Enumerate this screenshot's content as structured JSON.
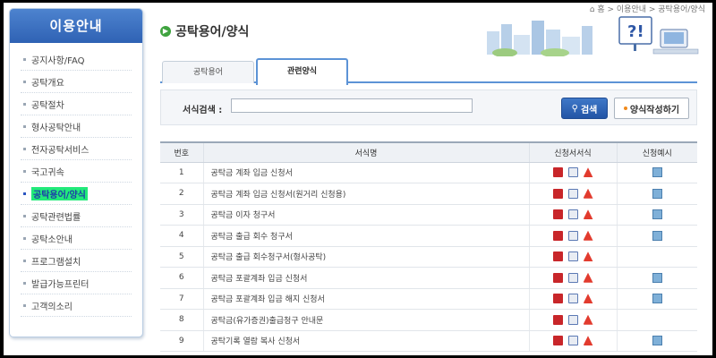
{
  "breadcrumb": [
    "홈",
    "이용안내",
    "공탁용어/양식"
  ],
  "sidebar": {
    "title": "이용안내",
    "items": [
      {
        "label": "공지사항/FAQ"
      },
      {
        "label": "공탁개요"
      },
      {
        "label": "공탁절차"
      },
      {
        "label": "형사공탁안내"
      },
      {
        "label": "전자공탁서비스"
      },
      {
        "label": "국고귀속"
      },
      {
        "label": "공탁용어/양식",
        "active": true
      },
      {
        "label": "공탁관련법률"
      },
      {
        "label": "공탁소안내"
      },
      {
        "label": "프로그램설치"
      },
      {
        "label": "발급가능프린터"
      },
      {
        "label": "고객의소리"
      }
    ]
  },
  "page": {
    "title": "공탁용어/양식"
  },
  "tabs": [
    {
      "label": "공탁용어"
    },
    {
      "label": "관련양식",
      "active": true
    }
  ],
  "search": {
    "label": "서식검색 :",
    "value": "",
    "button_label": "검색",
    "write_label": "양식작성하기"
  },
  "table": {
    "headers": [
      "번호",
      "서식명",
      "신청서서식",
      "신청예시"
    ],
    "rows": [
      {
        "num": "1",
        "name": "공탁금 계좌 입금 신청서",
        "formats": [
          "hwp",
          "doc",
          "pdf"
        ],
        "example": true
      },
      {
        "num": "2",
        "name": "공탁금 계좌 입금 신청서(원거리 신청용)",
        "formats": [
          "hwp",
          "doc",
          "pdf"
        ],
        "example": true
      },
      {
        "num": "3",
        "name": "공탁금 이자 청구서",
        "formats": [
          "hwp",
          "doc",
          "pdf"
        ],
        "example": true
      },
      {
        "num": "4",
        "name": "공탁금 출급 회수 청구서",
        "formats": [
          "hwp",
          "doc",
          "pdf"
        ],
        "example": true
      },
      {
        "num": "5",
        "name": "공탁금 출급 회수청구서(형사공탁)",
        "formats": [
          "hwp",
          "doc",
          "pdf"
        ],
        "example": false
      },
      {
        "num": "6",
        "name": "공탁금 포괄계좌 입금 신청서",
        "formats": [
          "hwp",
          "doc",
          "pdf"
        ],
        "example": true
      },
      {
        "num": "7",
        "name": "공탁금 포괄계좌 입금 해지 신청서",
        "formats": [
          "hwp",
          "doc",
          "pdf"
        ],
        "example": true
      },
      {
        "num": "8",
        "name": "공탁금(유가증권)출급청구 안내문",
        "formats": [
          "hwp",
          "doc",
          "pdf"
        ],
        "example": false
      },
      {
        "num": "9",
        "name": "공탁기록 열람 복사 신청서",
        "formats": [
          "hwp",
          "doc",
          "pdf"
        ],
        "example": true
      }
    ]
  },
  "colors": {
    "accent": "#2f62b4",
    "active_highlight": "#22ea7a",
    "tab_border": "#5c93d6"
  },
  "icons": {
    "hwp": "hwp-file-icon",
    "doc": "word-file-icon",
    "pdf": "pdf-file-icon",
    "example": "save-icon"
  }
}
